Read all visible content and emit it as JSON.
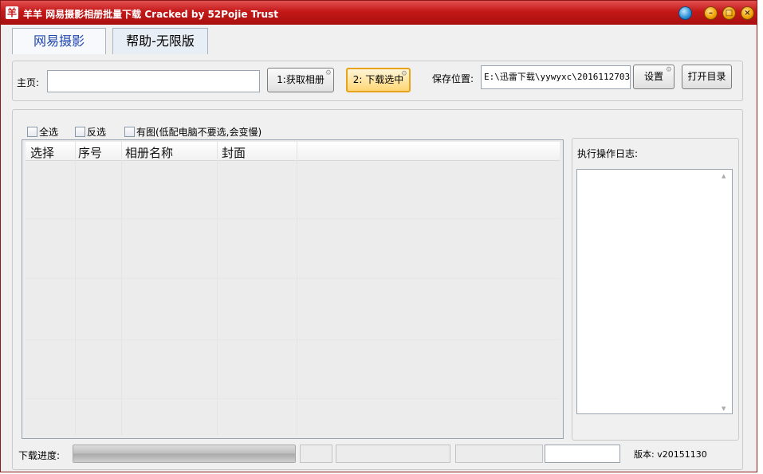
{
  "window": {
    "title": "羊羊 网易摄影相册批量下载 Cracked by 52Pojie Trust",
    "app_icon_char": "羊",
    "title_buttons": {
      "skin": "skin-icon",
      "minimize": "minimize-icon",
      "maximize": "maximize-icon",
      "close": "close-icon"
    }
  },
  "tabs": [
    {
      "label": "网易摄影",
      "active": true
    },
    {
      "label": "帮助-无限版",
      "active": false
    }
  ],
  "top": {
    "homepage_label": "主页:",
    "homepage_value": "",
    "fetch_button": "1:获取相册",
    "download_button": "2: 下载选中",
    "save_label": "保存位置:",
    "save_path": "E:\\迅雷下载\\yywyxc\\2016112703",
    "settings_button": "设置",
    "open_dir_button": "打开目录"
  },
  "options": {
    "select_all": "全选",
    "invert": "反选",
    "with_image": "有图(低配电脑不要选,会变慢)"
  },
  "table": {
    "columns": [
      "选择",
      "序号",
      "相册名称",
      "封面"
    ],
    "rows": []
  },
  "log": {
    "label": "执行操作日志:",
    "content": ""
  },
  "status": {
    "progress_label": "下载进度:",
    "progress": 1.0,
    "version": "版本: v20151130"
  },
  "colors": {
    "title_bar": "#c41818",
    "active_tab_text": "#2046b0",
    "highlight_button": "#ffd675"
  }
}
